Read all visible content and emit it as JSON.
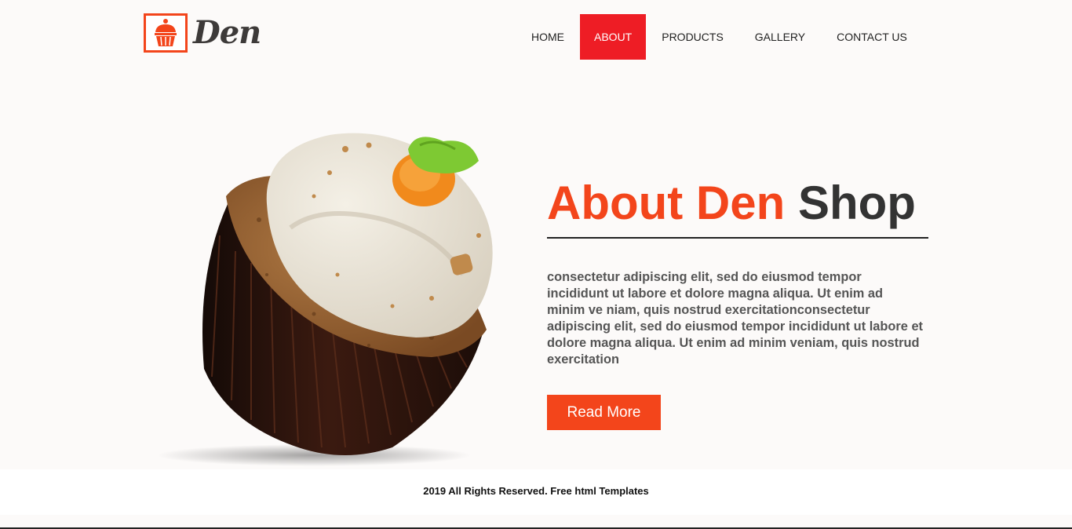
{
  "brand": {
    "name": "Den",
    "logo_icon": "cupcake-icon",
    "accent_color": "#f3451b"
  },
  "nav": {
    "items": [
      {
        "label": "HOME",
        "active": false
      },
      {
        "label": "ABOUT",
        "active": true
      },
      {
        "label": "PRODUCTS",
        "active": false
      },
      {
        "label": "GALLERY",
        "active": false
      },
      {
        "label": "CONTACT US",
        "active": false
      }
    ],
    "active_color": "#ee1d25"
  },
  "about": {
    "title_part1": "About Den",
    "title_part2": "Shop",
    "text": "consectetur adipiscing elit, sed do eiusmod tempor incididunt ut labore et dolore magna aliqua. Ut enim ad minim ve niam, quis nostrud exercitationconsectetur adipiscing elit, sed do eiusmod tempor incididunt ut labore et dolore magna aliqua. Ut enim ad minim veniam, quis nostrud exercitation",
    "button_label": "Read More",
    "image": "carrot-cupcake-image"
  },
  "footer": {
    "copyright": "2019 All Rights Reserved. Free html Templates"
  }
}
